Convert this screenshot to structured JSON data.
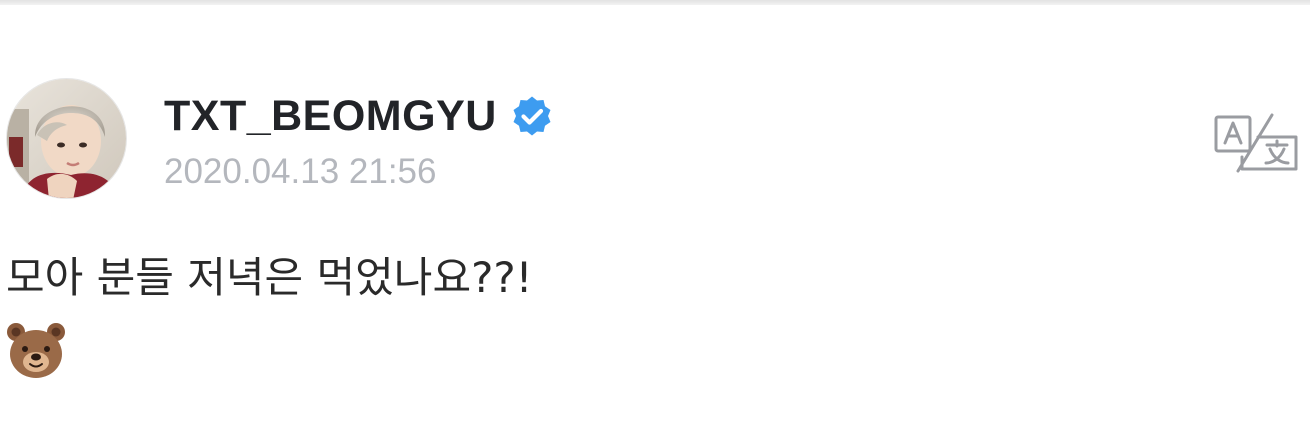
{
  "post": {
    "author": {
      "username": "TXT_BEOMGYU",
      "verified": true,
      "avatar_icon": "profile-photo"
    },
    "timestamp": "2020.04.13 21:56",
    "translate_icon": "translate-icon",
    "message": {
      "text": "모아 분들 저녁은 먹었나요??!",
      "emoji_icon": "bear-face-emoji"
    }
  },
  "colors": {
    "background": "#ffffff",
    "username": "#222428",
    "timestamp": "#b4b7bd",
    "verified_badge": "#3d9cf0",
    "translate_icon": "#9a9ca1",
    "message_text": "#2a2a2a"
  }
}
